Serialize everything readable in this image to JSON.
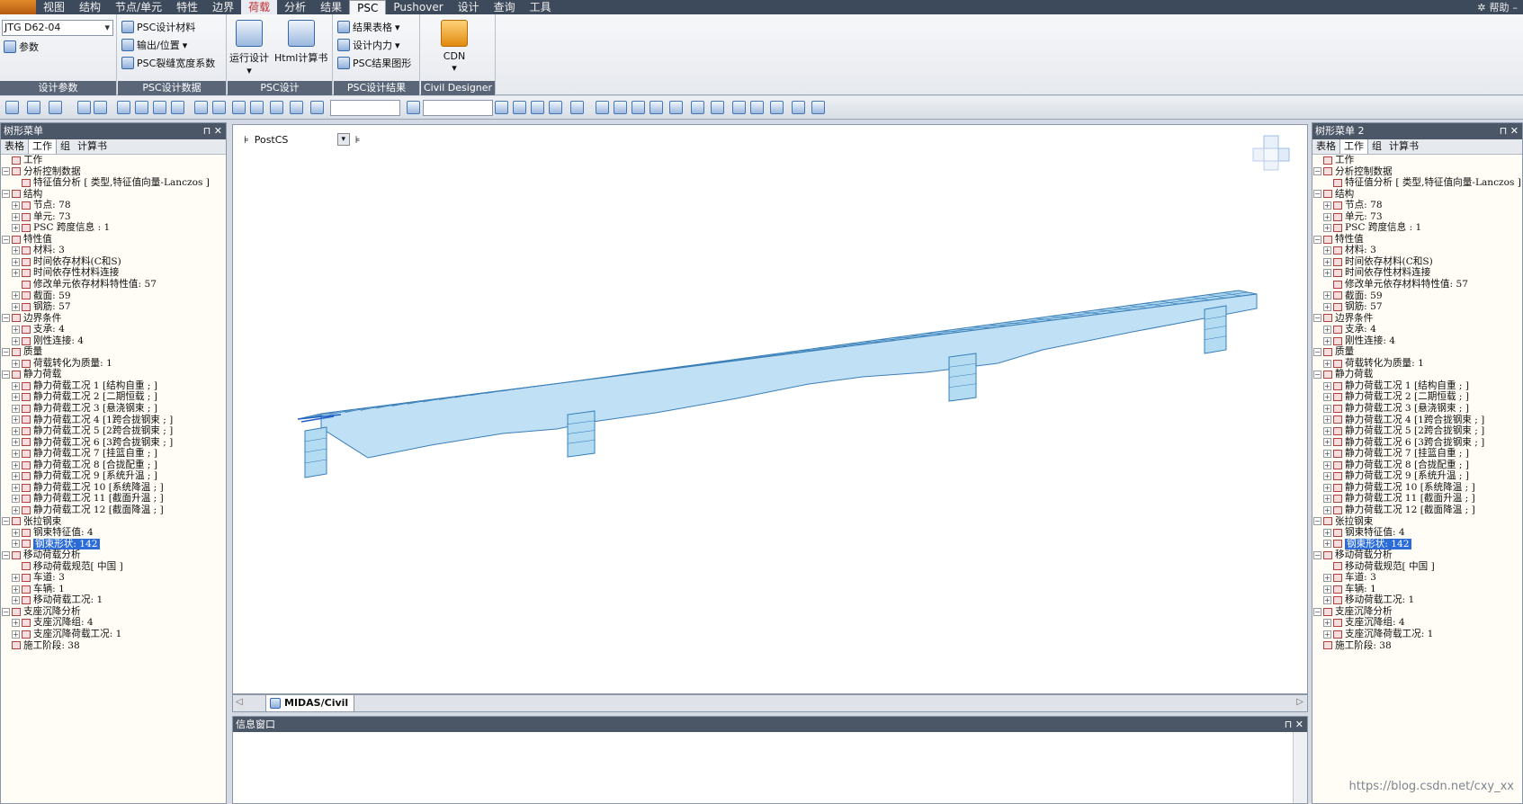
{
  "menubar": {
    "items": [
      "视图",
      "结构",
      "节点/单元",
      "特性",
      "边界",
      "荷载",
      "分析",
      "结果",
      "PSC",
      "Pushover",
      "设计",
      "查询",
      "工具"
    ],
    "active": "PSC",
    "hover": "荷载",
    "help": "帮助"
  },
  "ribbon": {
    "design_params": {
      "code_select": "JTG D62-04",
      "params": "参数",
      "title": "设计参数"
    },
    "psc_data": {
      "material": "PSC设计材料",
      "output": "输出/位置",
      "crack": "PSC裂缝宽度系数",
      "title": "PSC设计数据"
    },
    "psc_design": {
      "run": "运行设计",
      "html": "Html计算书",
      "title": "PSC设计"
    },
    "psc_results": {
      "table": "结果表格",
      "force": "设计内力",
      "graph": "PSC结果图形",
      "title": "PSC设计结果"
    },
    "civil_designer": {
      "cdn": "CDN",
      "title": "Civil Designer"
    }
  },
  "left_panel": {
    "title": "树形菜单",
    "tabs": [
      "表格",
      "工作",
      "组",
      "计算书"
    ],
    "active_tab": "工作"
  },
  "right_panel": {
    "title": "树形菜单 2",
    "tabs": [
      "表格",
      "工作",
      "组",
      "计算书"
    ],
    "active_tab": "工作"
  },
  "tree": [
    {
      "lvl": 0,
      "t": "工作"
    },
    {
      "lvl": 0,
      "t": "分析控制数据"
    },
    {
      "lvl": 1,
      "t": "特征值分析 [ 类型,特征值向量-Lanczos ]",
      "leaf": true
    },
    {
      "lvl": 0,
      "t": "结构"
    },
    {
      "lvl": 1,
      "t": "节点: 78"
    },
    {
      "lvl": 1,
      "t": "单元: 73"
    },
    {
      "lvl": 1,
      "t": "PSC 跨度信息 : 1"
    },
    {
      "lvl": 0,
      "t": "特性值"
    },
    {
      "lvl": 1,
      "t": "材料: 3"
    },
    {
      "lvl": 1,
      "t": "时间依存材料(C和S)"
    },
    {
      "lvl": 1,
      "t": "时间依存性材料连接"
    },
    {
      "lvl": 1,
      "t": "修改单元依存材料特性值: 57",
      "leaf": true
    },
    {
      "lvl": 1,
      "t": "截面: 59"
    },
    {
      "lvl": 1,
      "t": "钢筋: 57"
    },
    {
      "lvl": 0,
      "t": "边界条件"
    },
    {
      "lvl": 1,
      "t": "支承: 4"
    },
    {
      "lvl": 1,
      "t": "刚性连接: 4"
    },
    {
      "lvl": 0,
      "t": "质量"
    },
    {
      "lvl": 1,
      "t": "荷载转化为质量: 1"
    },
    {
      "lvl": 0,
      "t": "静力荷载"
    },
    {
      "lvl": 1,
      "t": "静力荷载工况 1 [结构自重 ; ]"
    },
    {
      "lvl": 1,
      "t": "静力荷载工况 2 [二期恒载 ; ]"
    },
    {
      "lvl": 1,
      "t": "静力荷载工况 3 [悬浇钢束 ; ]"
    },
    {
      "lvl": 1,
      "t": "静力荷载工况 4 [1跨合拢钢束 ; ]"
    },
    {
      "lvl": 1,
      "t": "静力荷载工况 5 [2跨合拢钢束 ; ]"
    },
    {
      "lvl": 1,
      "t": "静力荷载工况 6 [3跨合拢钢束 ; ]"
    },
    {
      "lvl": 1,
      "t": "静力荷载工况 7 [挂篮自重 ; ]"
    },
    {
      "lvl": 1,
      "t": "静力荷载工况 8 [合拢配重 ; ]"
    },
    {
      "lvl": 1,
      "t": "静力荷载工况 9 [系统升温 ; ]"
    },
    {
      "lvl": 1,
      "t": "静力荷载工况 10 [系统降温 ; ]"
    },
    {
      "lvl": 1,
      "t": "静力荷载工况 11 [截面升温 ; ]"
    },
    {
      "lvl": 1,
      "t": "静力荷载工况 12 [截面降温 ; ]"
    },
    {
      "lvl": 0,
      "t": "张拉钢束"
    },
    {
      "lvl": 1,
      "t": "钢束特征值: 4"
    },
    {
      "lvl": 1,
      "t": "钢束形状: 142",
      "sel": true
    },
    {
      "lvl": 0,
      "t": "移动荷载分析"
    },
    {
      "lvl": 1,
      "t": "移动荷载规范[ 中国 ]",
      "leaf": true
    },
    {
      "lvl": 1,
      "t": "车道: 3"
    },
    {
      "lvl": 1,
      "t": "车辆: 1"
    },
    {
      "lvl": 1,
      "t": "移动荷载工况: 1"
    },
    {
      "lvl": 0,
      "t": "支座沉降分析"
    },
    {
      "lvl": 1,
      "t": "支座沉降组: 4"
    },
    {
      "lvl": 1,
      "t": "支座沉降荷载工况: 1"
    },
    {
      "lvl": 0,
      "t": "施工阶段: 38",
      "leaf": true
    }
  ],
  "viewport": {
    "stage": "PostCS"
  },
  "doc_tab": "MIDAS/Civil",
  "info_window": {
    "title": "信息窗口"
  },
  "watermark": "https://blog.csdn.net/cxy_xx",
  "colors": {
    "accent": "#2b6cd8",
    "bridge": "#a9d4ef",
    "bridge_line": "#3b7fb8"
  }
}
